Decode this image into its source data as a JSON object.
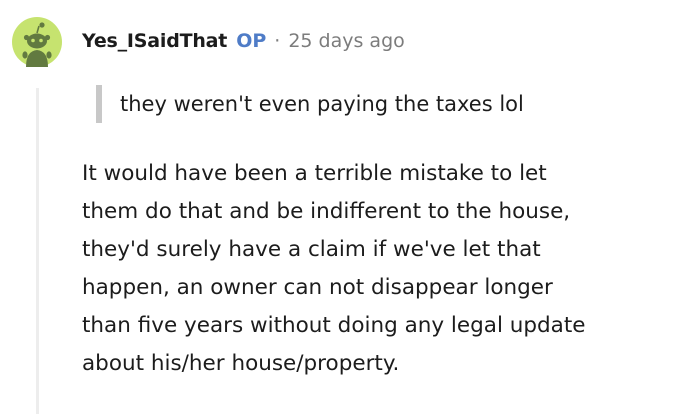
{
  "comment": {
    "username": "Yes_ISaidThat",
    "op_tag": "OP",
    "separator": "·",
    "timestamp": "25 days ago",
    "quote": "they weren't even paying the taxes lol",
    "body_lines": [
      "It would have been a terrible mistake to let",
      "them do that and be indifferent to the house,",
      "they'd surely have a claim if we've let that",
      "happen, an owner can not disappear longer",
      "than five years without doing any legal update",
      "about his/her house/property."
    ]
  },
  "icons": {
    "avatar": "snoo-avatar-icon"
  },
  "colors": {
    "avatar_bg": "#c6e36f",
    "avatar_figure": "#627a40",
    "op_tag": "#4f7cc7",
    "meta_text": "#7c7c7c",
    "quote_bar": "#c8c8c8",
    "thread_line": "#ededed"
  }
}
